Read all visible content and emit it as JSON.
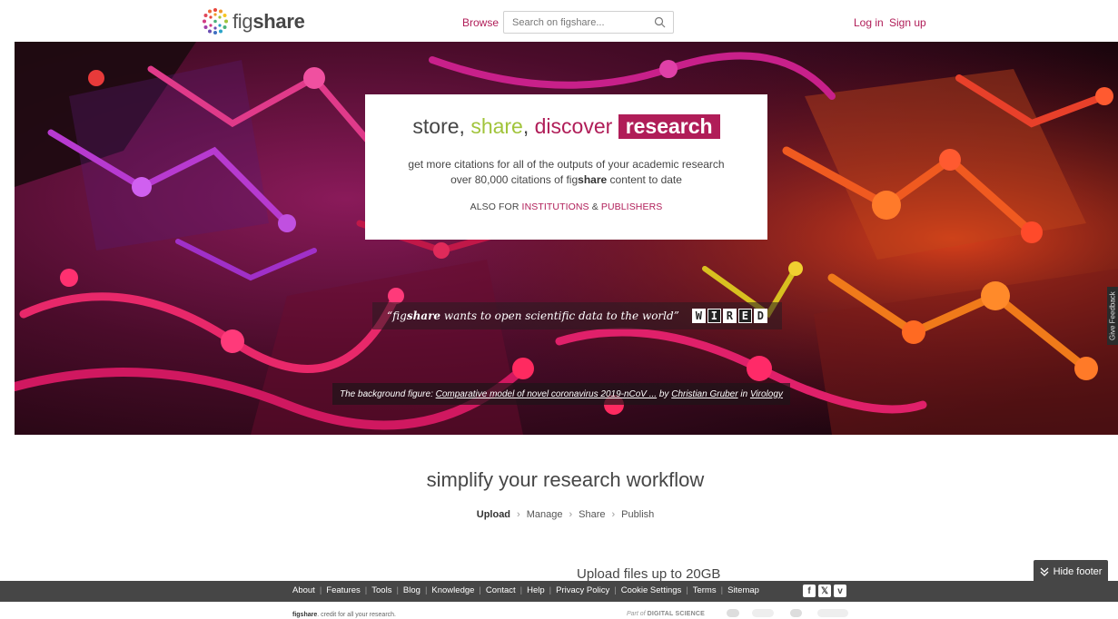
{
  "header": {
    "logo_text": "fig",
    "logo_text_bold": "share",
    "browse": "Browse",
    "search_placeholder": "Search on figshare...",
    "login": "Log in",
    "signup": "Sign up"
  },
  "hero": {
    "tag_store": "store,",
    "tag_share": "share",
    "tag_comma": ",",
    "tag_discover": "discover",
    "tag_research": "research",
    "desc_line1": "get more citations for all of the outputs of your academic research",
    "desc_line2_pre": "over 80,000 citations of fig",
    "desc_line2_bold": "share",
    "desc_line2_post": "content to date",
    "also_for": "ALSO FOR",
    "institutions": "INSTITUTIONS",
    "amp": "&",
    "publishers": "PUBLISHERS",
    "quote_pre": "“fig",
    "quote_bold": "share",
    "quote_post": "wants to open scientific data to the world”",
    "wired_letters": [
      "W",
      "I",
      "R",
      "E",
      "D"
    ],
    "caption_pre": "The background figure:",
    "caption_title": "Comparative model of novel coronavirus 2019-nCoV ...",
    "caption_by": "by",
    "caption_author": "Christian Gruber",
    "caption_in": "in",
    "caption_category": "Virology",
    "feedback": "Give Feedback"
  },
  "workflow": {
    "title": "simplify your research workflow",
    "steps": [
      "Upload",
      "Manage",
      "Share",
      "Publish"
    ],
    "upload_title": "Upload files up to 20GB"
  },
  "hide_footer": "Hide footer",
  "footer": {
    "links": [
      "About",
      "Features",
      "Tools",
      "Blog",
      "Knowledge",
      "Contact",
      "Help",
      "Privacy Policy",
      "Cookie Settings",
      "Terms",
      "Sitemap"
    ],
    "social": [
      "f",
      "𝕏",
      "v"
    ],
    "credit_bold": "figshare",
    "credit_rest": ". credit for all your research.",
    "part_of": "Part of",
    "digital_science": "DIGITAL SCIENCE"
  },
  "colors": {
    "accent": "#b01d58",
    "green": "#a1c43b",
    "footer_bg": "#464646"
  }
}
